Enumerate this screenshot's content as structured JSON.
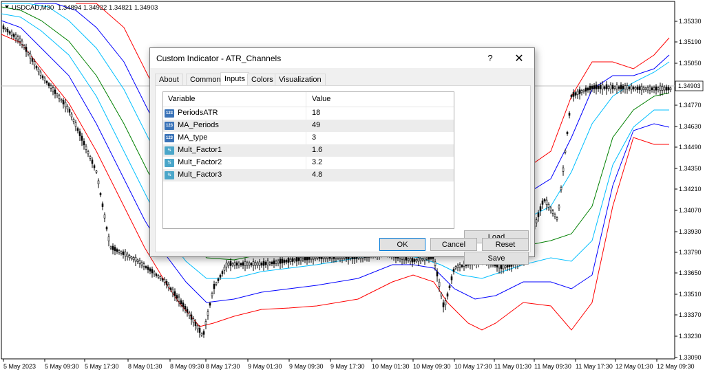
{
  "chart_header": {
    "symbol": "USDCAD,M30",
    "quote": "1.34894 1.34922 1.34821 1.34903"
  },
  "current_price": "1.34903",
  "price_axis": [
    "1.35330",
    "1.35190",
    "1.35050",
    "1.34770",
    "1.34630",
    "1.34490",
    "1.34350",
    "1.34210",
    "1.34070",
    "1.33930",
    "1.33790",
    "1.33650",
    "1.33510",
    "1.33370",
    "1.33230",
    "1.33090"
  ],
  "time_axis": [
    "5 May 2023",
    "5 May 09:30",
    "5 May 17:30",
    "8 May 01:30",
    "8 May 09:30",
    "8 May 17:30",
    "9 May 01:30",
    "9 May 09:30",
    "9 May 17:30",
    "10 May 01:30",
    "10 May 09:30",
    "10 May 17:30",
    "11 May 01:30",
    "11 May 09:30",
    "11 May 17:30",
    "12 May 01:30",
    "12 May 09:30"
  ],
  "colors": {
    "band3": "#ff0000",
    "band2": "#0000ff",
    "band1": "#00bfff",
    "ma": "#008000",
    "candle": "#000000",
    "dialog_bg": "#f0f0f0",
    "ok_border": "#0078d7"
  },
  "dialog": {
    "title": "Custom Indicator - ATR_Channels",
    "help_label": "?",
    "close_label": "✕",
    "tabs": [
      {
        "label": "About"
      },
      {
        "label": "Common"
      },
      {
        "label": "Inputs"
      },
      {
        "label": "Colors"
      },
      {
        "label": "Visualization"
      }
    ],
    "active_tab": "Inputs",
    "table": {
      "col_variable": "Variable",
      "col_value": "Value",
      "rows": [
        {
          "icon": "int-param-icon",
          "icon_text": "123",
          "variable": "PeriodsATR",
          "value": "18"
        },
        {
          "icon": "int-param-icon",
          "icon_text": "123",
          "variable": "MA_Periods",
          "value": "49"
        },
        {
          "icon": "int-param-icon",
          "icon_text": "123",
          "variable": "MA_type",
          "value": "3"
        },
        {
          "icon": "double-param-icon",
          "icon_text": "½",
          "variable": "Mult_Factor1",
          "value": "1.6"
        },
        {
          "icon": "double-param-icon",
          "icon_text": "½",
          "variable": "Mult_Factor2",
          "value": "3.2"
        },
        {
          "icon": "double-param-icon",
          "icon_text": "½",
          "variable": "Mult_Factor3",
          "value": "4.8"
        }
      ]
    },
    "load_label": "Load",
    "save_label": "Save",
    "ok_label": "OK",
    "cancel_label": "Cancel",
    "reset_label": "Reset"
  }
}
